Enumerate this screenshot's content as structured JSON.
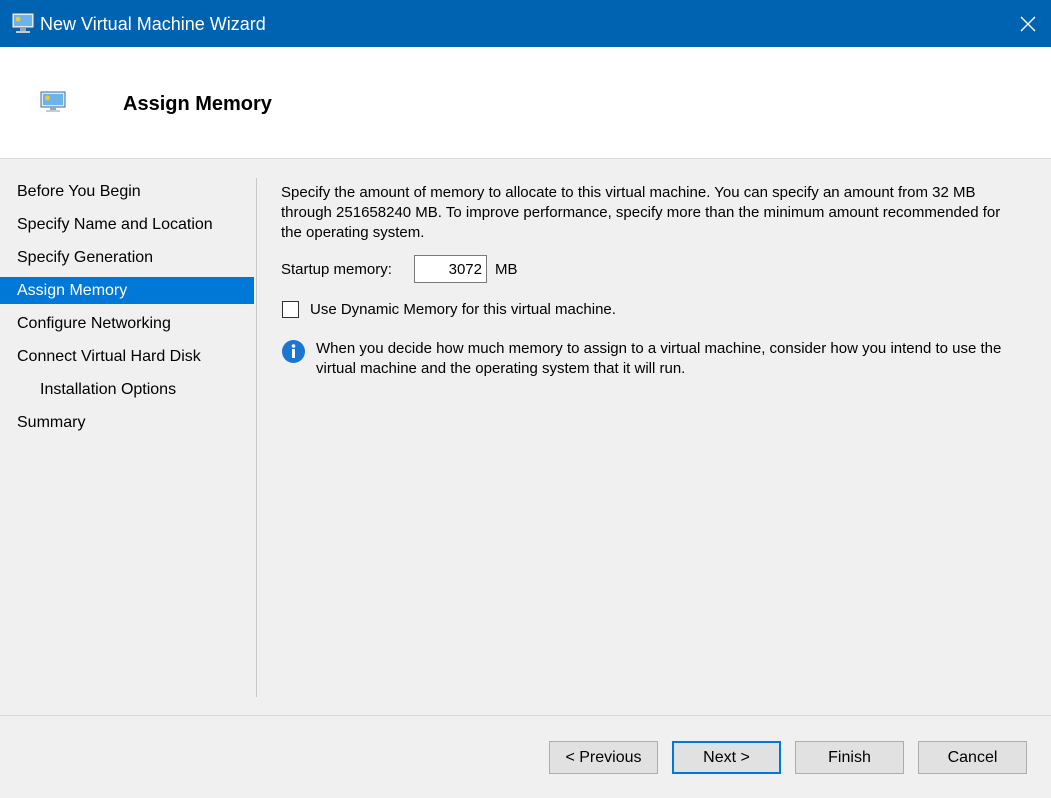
{
  "window": {
    "title": "New Virtual Machine Wizard"
  },
  "header": {
    "title": "Assign Memory"
  },
  "nav": {
    "items": [
      {
        "label": "Before You Begin"
      },
      {
        "label": "Specify Name and Location"
      },
      {
        "label": "Specify Generation"
      },
      {
        "label": "Assign Memory"
      },
      {
        "label": "Configure Networking"
      },
      {
        "label": "Connect Virtual Hard Disk"
      },
      {
        "label": "Installation Options"
      },
      {
        "label": "Summary"
      }
    ],
    "selected": "Assign Memory"
  },
  "main": {
    "description": "Specify the amount of memory to allocate to this virtual machine. You can specify an amount from 32 MB through 251658240 MB. To improve performance, specify more than the minimum amount recommended for the operating system.",
    "startup_memory_label": "Startup memory:",
    "startup_memory_value": "3072",
    "startup_memory_unit": "MB",
    "dynamic_memory_label": "Use Dynamic Memory for this virtual machine.",
    "dynamic_memory_checked": false,
    "info_text": "When you decide how much memory to assign to a virtual machine, consider how you intend to use the virtual machine and the operating system that it will run."
  },
  "buttons": {
    "previous": "< Previous",
    "next": "Next >",
    "finish": "Finish",
    "cancel": "Cancel"
  },
  "icons": {
    "app": "virtual-machine-icon",
    "header": "virtual-machine-icon",
    "close": "close-icon",
    "info": "info-icon"
  },
  "colors": {
    "titlebar": "#0063b1",
    "selection": "#0078d7",
    "info": "#1976d2"
  }
}
